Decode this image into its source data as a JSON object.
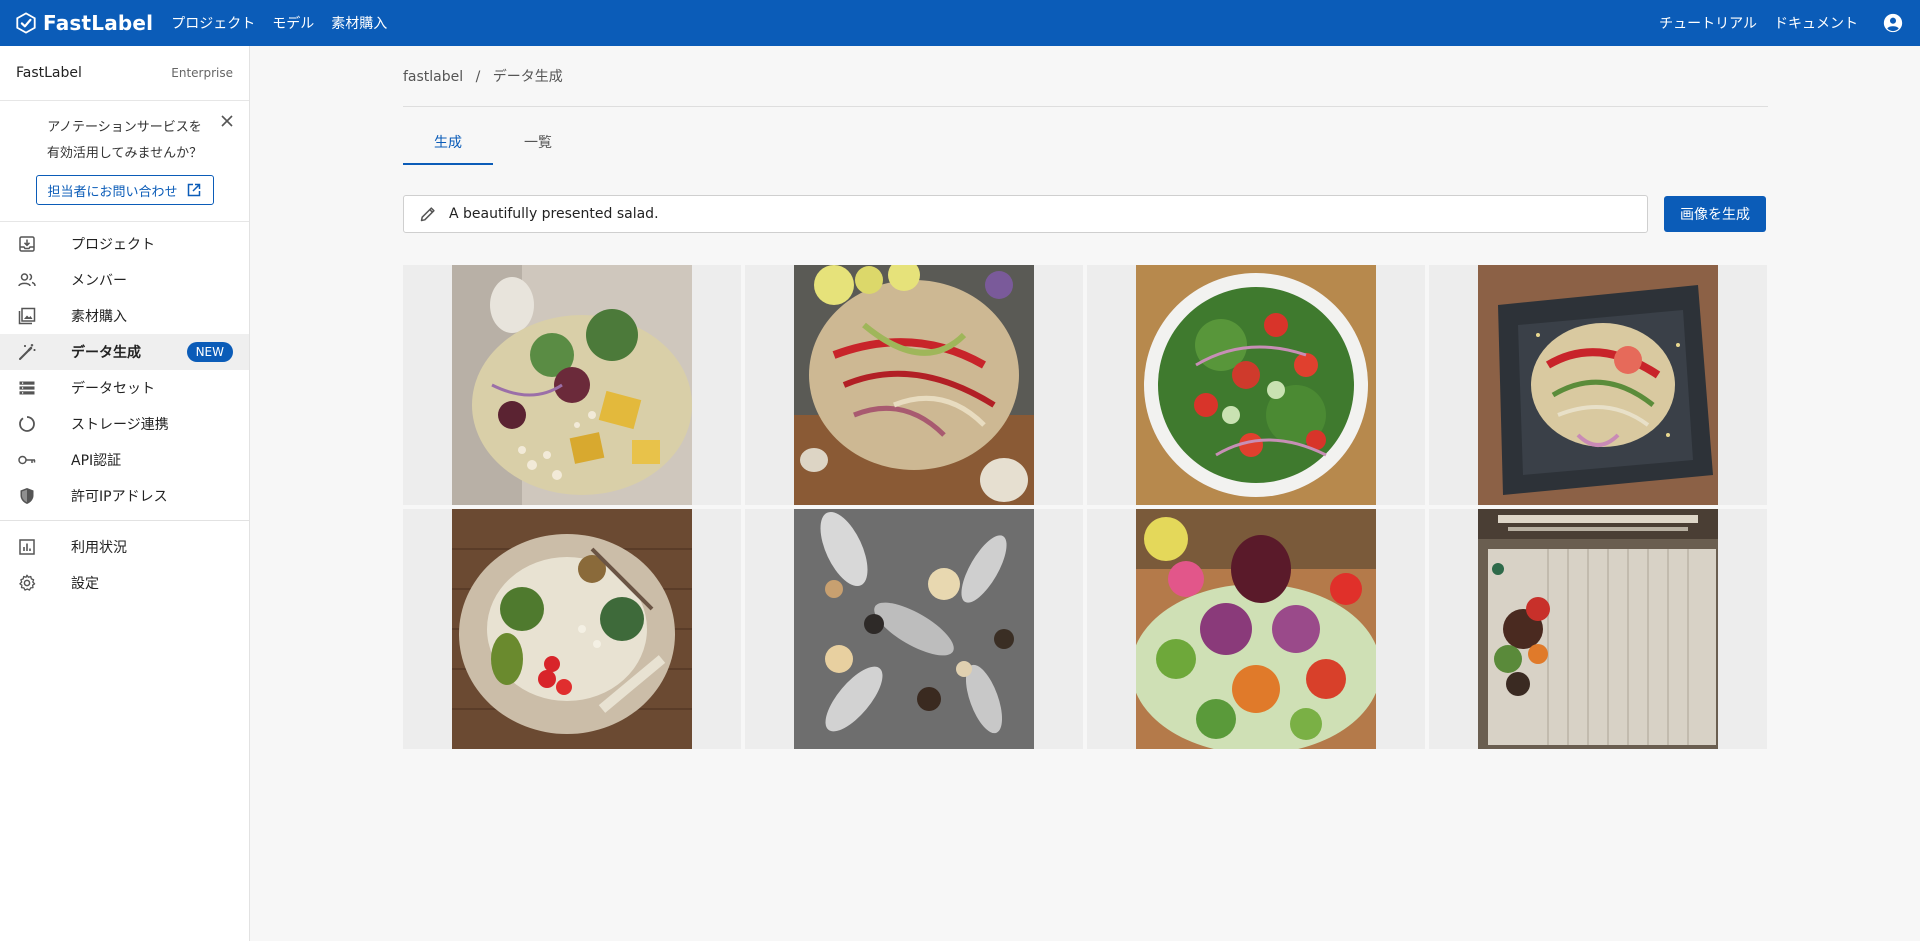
{
  "topbar": {
    "brand": "FastLabel",
    "nav": [
      "プロジェクト",
      "モデル",
      "素材購入"
    ],
    "right_links": [
      "チュートリアル",
      "ドキュメント"
    ]
  },
  "sidebar": {
    "org_name": "FastLabel",
    "plan": "Enterprise",
    "promo": {
      "line1": "アノテーションサービスを",
      "line2": "有効活用してみませんか？",
      "button": "担当者にお問い合わせ"
    },
    "items": [
      {
        "label": "プロジェクト",
        "icon": "inbox-download-icon"
      },
      {
        "label": "メンバー",
        "icon": "people-icon"
      },
      {
        "label": "素材購入",
        "icon": "image-library-icon"
      },
      {
        "label": "データ生成",
        "icon": "magic-wand-icon",
        "badge": "NEW",
        "active": true
      },
      {
        "label": "データセット",
        "icon": "list-icon"
      },
      {
        "label": "ストレージ連携",
        "icon": "sync-icon"
      },
      {
        "label": "API認証",
        "icon": "key-icon"
      },
      {
        "label": "許可IPアドレス",
        "icon": "shield-icon"
      }
    ],
    "bottom_items": [
      {
        "label": "利用状況",
        "icon": "bar-chart-icon"
      },
      {
        "label": "設定",
        "icon": "gear-icon"
      }
    ]
  },
  "main": {
    "breadcrumb": [
      "fastlabel",
      "データ生成"
    ],
    "tabs": [
      "生成",
      "一覧"
    ],
    "prompt": {
      "value": "A beautifully presented salad.",
      "button": "画像を生成"
    }
  },
  "colors": {
    "primary": "#0b5cb8",
    "sidebar_active_bg": "#efefef"
  }
}
